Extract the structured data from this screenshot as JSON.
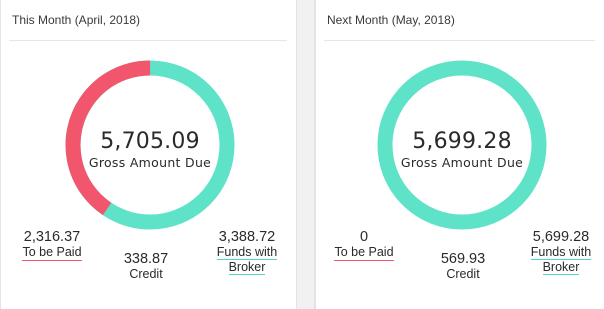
{
  "colors": {
    "to_be_paid": "#f2566d",
    "funds_with_broker": "#5fe3c8"
  },
  "panels": [
    {
      "title": "This Month (April, 2018)",
      "gross_amount": "5,705.09",
      "gross_label": "Gross Amount Due",
      "to_be_paid_value": "2,316.37",
      "to_be_paid_label": "To be Paid",
      "credit_value": "338.87",
      "credit_label": "Credit",
      "funds_value": "3,388.72",
      "funds_label_line1": "Funds with",
      "funds_label_line2": "Broker",
      "donut_red_fraction": 0.406
    },
    {
      "title": "Next Month (May, 2018)",
      "gross_amount": "5,699.28",
      "gross_label": "Gross Amount Due",
      "to_be_paid_value": "0",
      "to_be_paid_label": "To be Paid",
      "credit_value": "569.93",
      "credit_label": "Credit",
      "funds_value": "5,699.28",
      "funds_label_line1": "Funds with",
      "funds_label_line2": "Broker",
      "donut_red_fraction": 0
    }
  ]
}
